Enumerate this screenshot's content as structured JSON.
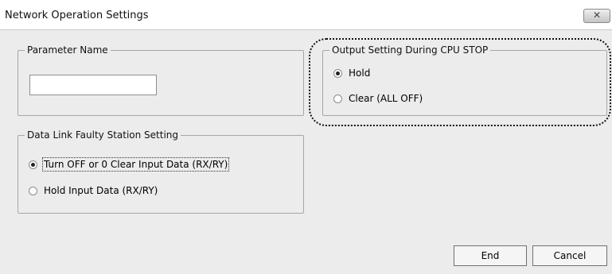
{
  "window": {
    "title": "Network Operation Settings",
    "close_icon": "close-icon"
  },
  "groups": {
    "parameter_name": {
      "legend": "Parameter Name",
      "input_value": ""
    },
    "output_setting": {
      "legend": "Output Setting During CPU STOP",
      "options": [
        {
          "label": "Hold",
          "checked": true
        },
        {
          "label": "Clear (ALL OFF)",
          "checked": false
        }
      ]
    },
    "faulty_station": {
      "legend": "Data Link Faulty Station Setting",
      "options": [
        {
          "label": "Turn OFF or 0 Clear Input Data (RX/RY)",
          "checked": true
        },
        {
          "label": "Hold Input Data (RX/RY)",
          "checked": false
        }
      ]
    }
  },
  "buttons": {
    "end": "End",
    "cancel": "Cancel"
  }
}
